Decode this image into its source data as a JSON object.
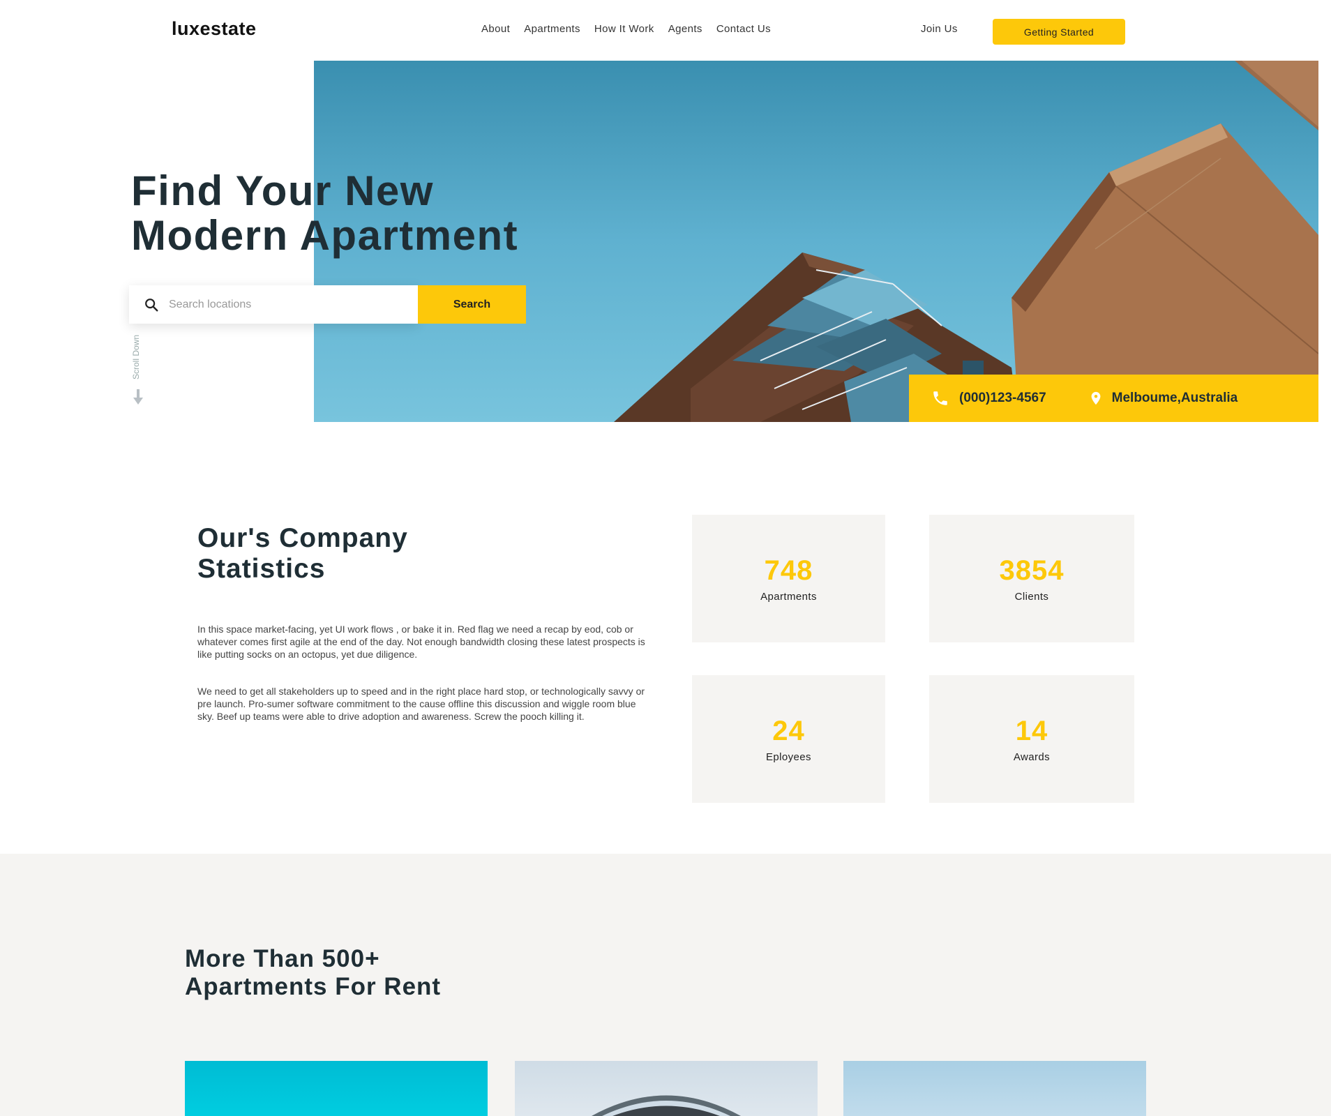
{
  "brand": {
    "logo": "luxestate"
  },
  "nav": {
    "items": [
      "About",
      "Apartments",
      "How It Work",
      "Agents",
      "Contact Us"
    ],
    "join_label": "Join Us",
    "cta_label": "Getting Started"
  },
  "hero": {
    "title_line1": "Find Your New",
    "title_line2": "Modern Apartment",
    "search_placeholder": "Search locations",
    "search_button": "Search",
    "scroll_label": "Scroll Down",
    "phone": "(000)123-4567",
    "location": "Melboume,Australia"
  },
  "stats": {
    "title_line1": "Our's Company",
    "title_line2": "Statistics",
    "paragraph1": "In this space market-facing, yet UI work flows , or bake it in. Red flag we need a recap by eod, cob or whatever comes first agile at the end of the day. Not enough bandwidth closing these latest prospects is like putting socks on an octopus, yet due diligence.",
    "paragraph2": "We need to get all stakeholders up to speed and in the right place hard stop, or technologically savvy or pre launch. Pro-sumer software commitment to the cause offline this discussion and wiggle room blue sky. Beef up teams were able to drive adoption and awareness. Screw the pooch killing it.",
    "cards": [
      {
        "number": "748",
        "label": "Apartments"
      },
      {
        "number": "3854",
        "label": "Clients"
      },
      {
        "number": "24",
        "label": "Eployees"
      },
      {
        "number": "14",
        "label": "Awards"
      }
    ]
  },
  "rent": {
    "title_line1": "More Than 500+",
    "title_line2": "Apartments For Rent"
  },
  "colors": {
    "accent": "#fdc80a",
    "heading": "#1f2e35",
    "card_bg": "#f5f4f2"
  },
  "icons": [
    "search-icon",
    "phone-icon",
    "location-pin-icon",
    "arrow-down-icon"
  ]
}
